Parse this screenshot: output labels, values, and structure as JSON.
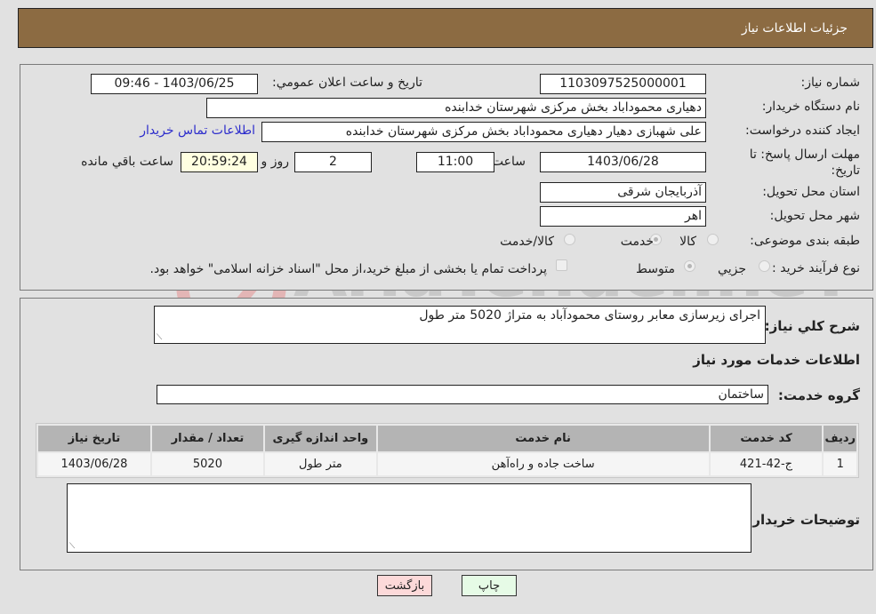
{
  "header": {
    "title": "جزئیات اطلاعات نیاز"
  },
  "form": {
    "need_number_label": "شماره نیاز:",
    "need_number": "1103097525000001",
    "announce_label": "تاريخ و ساعت اعلان عمومي:",
    "announce_value": "1403/06/25 - 09:46",
    "buyer_org_label": "نام دستگاه خریدار:",
    "buyer_org": "دهیاری محموداباد بخش مرکزی شهرستان خدابنده",
    "creator_label": "ایجاد کننده درخواست:",
    "creator": "علی شهبازی دهیار دهیاری محموداباد بخش مرکزی شهرستان خدابنده",
    "contact_link": "اطلاعات تماس خریدار",
    "deadline_label": "مهلت ارسال پاسخ: تا تاریخ:",
    "deadline_date": "1403/06/28",
    "time_label": "ساعت",
    "deadline_time": "11:00",
    "days_value": "2",
    "days_label": "روز و",
    "remaining_time": "20:59:24",
    "remaining_label": "ساعت باقي مانده",
    "province_label": "استان محل تحویل:",
    "province": "آذربایجان شرقی",
    "city_label": "شهر محل تحویل:",
    "city": "اهر",
    "category_label": "طبقه بندی موضوعی:",
    "category_options": [
      "کالا",
      "خدمت",
      "کالا/خدمت"
    ],
    "category_selected": "خدمت",
    "purchase_type_label": "نوع فرآیند خرید :",
    "purchase_type_options": [
      "جزيي",
      "متوسط"
    ],
    "purchase_type_selected": "متوسط",
    "treasury_checkbox_label": "پرداخت تمام یا بخشی از مبلغ خرید،از محل \"اسناد خزانه اسلامی\" خواهد بود.",
    "treasury_checked": false
  },
  "details": {
    "description_label": "شرح کلي نیاز:",
    "description": "اجرای زیرسازی معابر روستای محمودآباد به متراژ 5020 متر طول",
    "services_heading": "اطلاعات خدمات مورد نیاز",
    "service_group_label": "گروه خدمت:",
    "service_group": "ساختمان",
    "table": {
      "headers": [
        "ردیف",
        "کد خدمت",
        "نام خدمت",
        "واحد اندازه گیری",
        "تعداد / مقدار",
        "تاریخ نیاز"
      ],
      "rows": [
        [
          "1",
          "ج-42-421",
          "ساخت جاده و راه‌آهن",
          "متر طول",
          "5020",
          "1403/06/28"
        ]
      ]
    },
    "buyer_notes_label": "توضیحات خریدار:",
    "buyer_notes": ""
  },
  "buttons": {
    "print": "چاپ",
    "back": "بازگشت"
  },
  "watermark": {
    "text": "AriaTender.neT"
  }
}
